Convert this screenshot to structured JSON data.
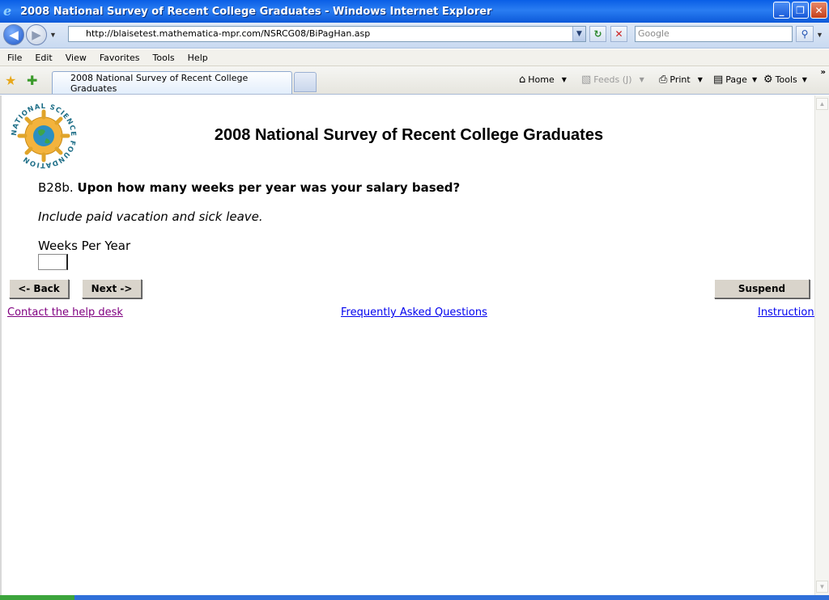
{
  "window": {
    "title": "2008 National Survey of Recent College Graduates - Windows Internet Explorer",
    "minimize": "_",
    "restore": "❐",
    "close": "✕"
  },
  "address_bar": {
    "url": "http://blaisetest.mathematica-mpr.com/NSRCG08/BiPagHan.asp",
    "search_placeholder": "Google"
  },
  "menu": [
    "File",
    "Edit",
    "View",
    "Favorites",
    "Tools",
    "Help"
  ],
  "tab": {
    "title": "2008 National Survey of Recent College Graduates"
  },
  "commands": {
    "home": "Home",
    "feeds": "Feeds (J)",
    "print": "Print",
    "page": "Page",
    "tools": "Tools"
  },
  "logo": {
    "text": "NATIONAL SCIENCE FOUNDATION",
    "accent": "#1f6f88"
  },
  "survey": {
    "title": "2008 National Survey of Recent College Graduates",
    "question_id": "B28b.",
    "question": "Upon how many weeks per year was your salary based?",
    "instruction": "Include paid vacation and sick leave.",
    "field_label": "Weeks Per Year",
    "field_value": ""
  },
  "buttons": {
    "back": "<- Back",
    "next": "Next ->",
    "suspend": "Suspend"
  },
  "links": {
    "help": "Contact the help desk",
    "faq": "Frequently Asked Questions",
    "instructions": "Instructions"
  }
}
